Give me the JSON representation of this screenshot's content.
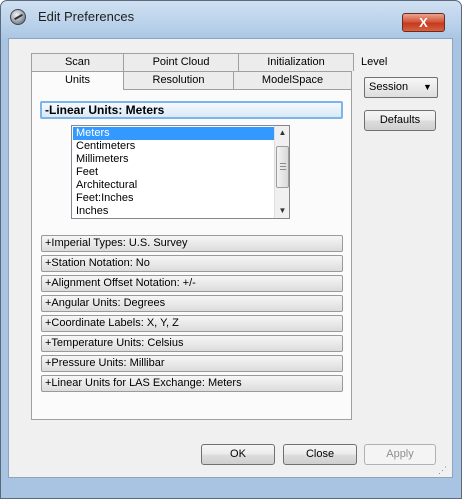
{
  "window": {
    "title": "Edit Preferences",
    "close_glyph": "X"
  },
  "tabs": {
    "row_back": [
      "Scan",
      "Point Cloud",
      "Initialization"
    ],
    "row_front": [
      "Units",
      "Resolution",
      "ModelSpace"
    ],
    "active": "Units"
  },
  "level": {
    "label": "Level",
    "selected": "Session"
  },
  "defaults_label": "Defaults",
  "open_section": {
    "label": "-Linear Units: Meters",
    "items": [
      "Meters",
      "Centimeters",
      "Millimeters",
      "Feet",
      "Architectural",
      "Feet:Inches",
      "Inches"
    ],
    "selected": "Meters"
  },
  "sections": [
    "+Imperial Types: U.S. Survey",
    "+Station Notation: No",
    "+Alignment Offset Notation: +/-",
    "+Angular Units: Degrees",
    "+Coordinate Labels: X, Y, Z",
    "+Temperature Units: Celsius",
    "+Pressure Units: Millibar",
    "+Linear Units for LAS Exchange: Meters"
  ],
  "buttons": {
    "ok": "OK",
    "close": "Close",
    "apply": "Apply"
  },
  "icons": {
    "app": "app-logo-icon",
    "close": "close-icon",
    "dropdown": "chevron-down-icon"
  }
}
